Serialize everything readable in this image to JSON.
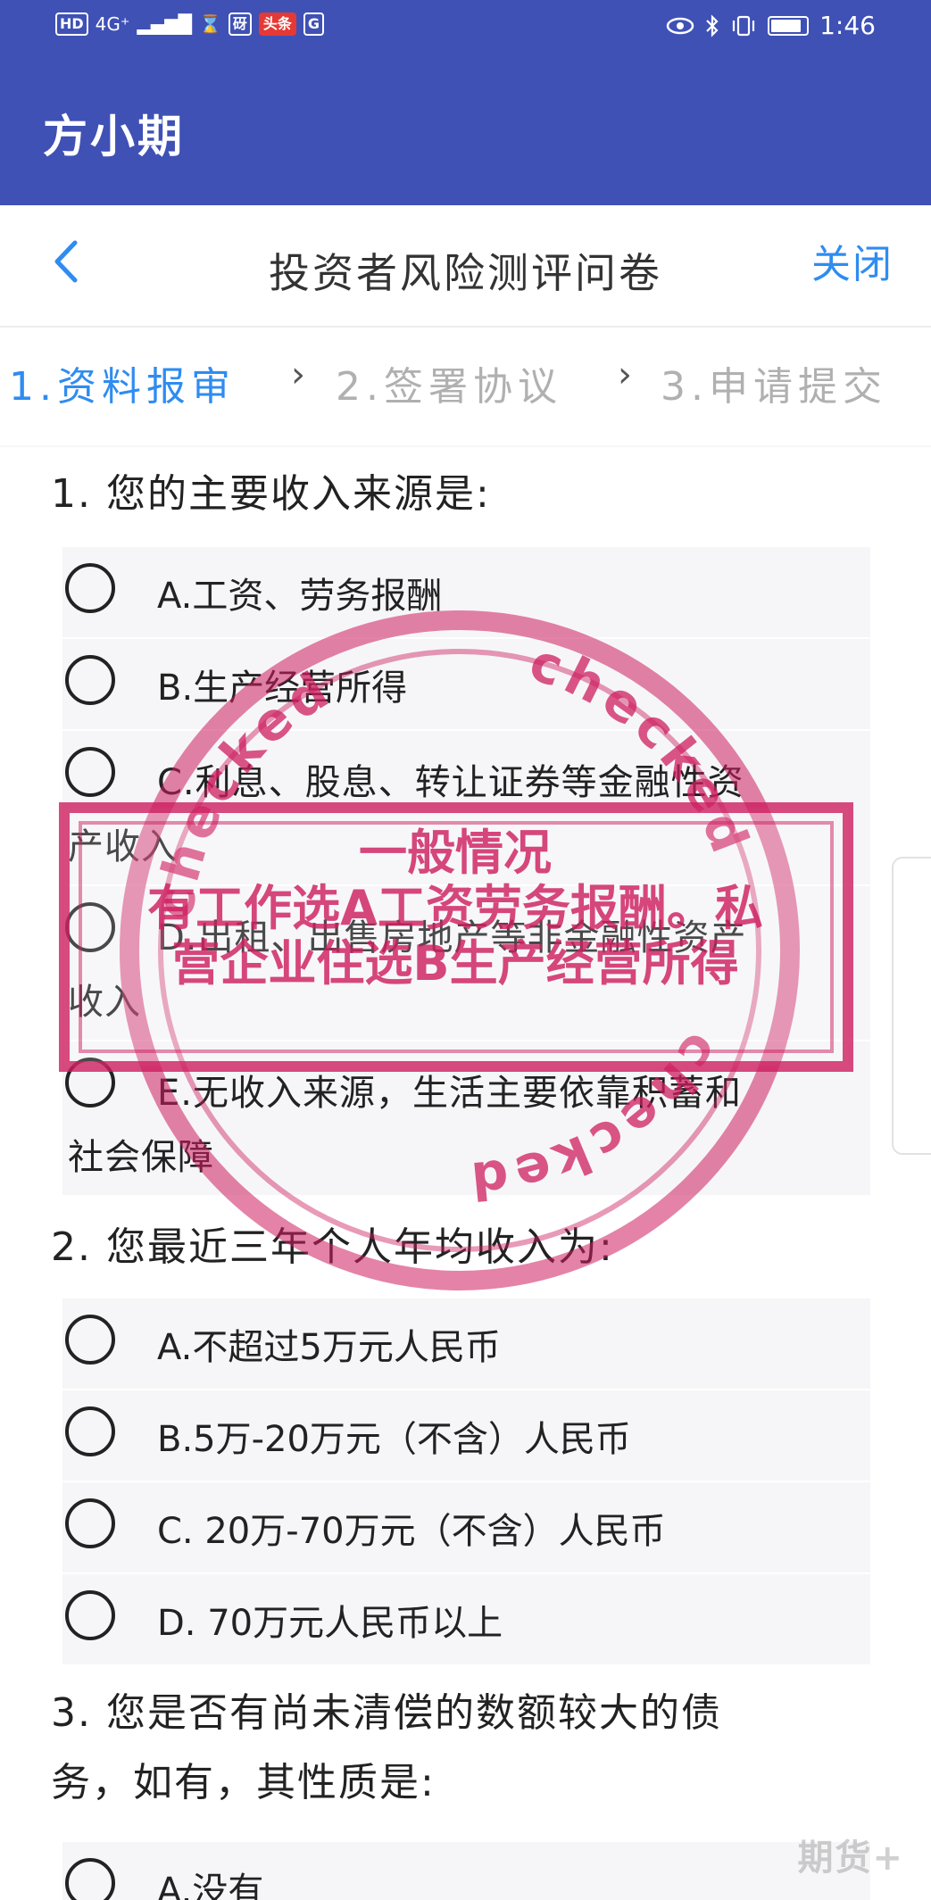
{
  "status_bar": {
    "left_items": [
      "HD",
      "4G⁺",
      "▂▄▆█",
      "⌛",
      "砑",
      "头条",
      "G"
    ],
    "time": "1:46"
  },
  "app_bar": {
    "title": "方小期"
  },
  "nav": {
    "title": "投资者风险测评问卷",
    "close_label": "关闭"
  },
  "steps": [
    {
      "label": "1.资料报审",
      "state": "active"
    },
    {
      "label": "2.签署协议",
      "state": "inactive"
    },
    {
      "label": "3.申请提交",
      "state": "inactive"
    }
  ],
  "questions": [
    {
      "title": "1. 您的主要收入来源是:",
      "options": [
        {
          "label": "A.工资、劳务报酬"
        },
        {
          "label": "B.生产经营所得"
        },
        {
          "line1": "C.利息、股息、转让证券等金融性资",
          "line2": "产收入"
        },
        {
          "line1": "D.出租、出售房地产等非金融性资产",
          "line2": "收入"
        },
        {
          "line1": "E.无收入来源，生活主要依靠积蓄和",
          "line2": "社会保障"
        }
      ]
    },
    {
      "title": "2. 您最近三年个人年均收入为:",
      "options": [
        {
          "label": "A.不超过5万元人民币"
        },
        {
          "label": "B.5万-20万元（不含）人民币"
        },
        {
          "label": "C. 20万-70万元（不含）人民币"
        },
        {
          "label": "D. 70万元人民币以上"
        }
      ]
    },
    {
      "title_line1": "3. 您是否有尚未清偿的数额较大的债",
      "title_line2": "务，如有，其性质是:",
      "options": [
        {
          "label": "A.没有"
        }
      ]
    }
  ],
  "stamp": {
    "ring_word": "checked",
    "text_lines": [
      "一般情况",
      "有工作选A工资劳务报酬。私",
      "营企业住选B生产经营所得"
    ]
  },
  "watermark": "期货+"
}
